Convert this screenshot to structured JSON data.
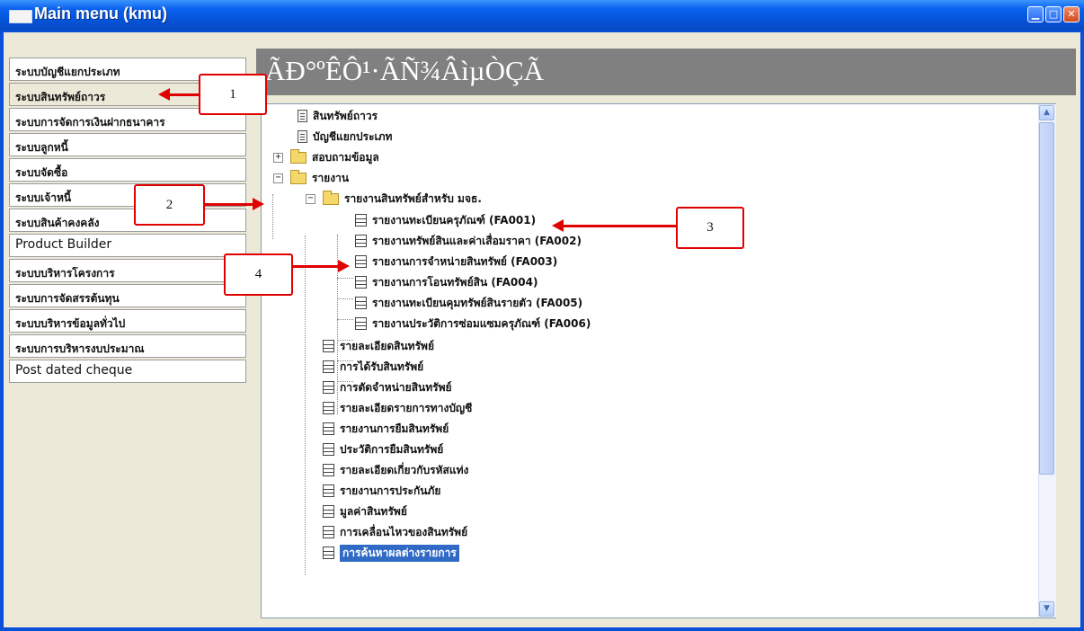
{
  "window": {
    "title": "Main menu (kmu)"
  },
  "sidebar": {
    "items": [
      {
        "label": "ระบบบัญชีแยกประเภท"
      },
      {
        "label": "ระบบสินทรัพย์ถาวร"
      },
      {
        "label": "ระบบการจัดการเงินฝากธนาคาร"
      },
      {
        "label": "ระบบลูกหนี้"
      },
      {
        "label": "ระบบจัดซื้อ"
      },
      {
        "label": "ระบบเจ้าหนี้"
      },
      {
        "label": "ระบบสินค้าคงคลัง"
      },
      {
        "label": "Product Builder"
      },
      {
        "label": "ระบบบริหารโครงการ"
      },
      {
        "label": "ระบบการจัดสรรต้นทุน"
      },
      {
        "label": "ระบบบริหารข้อมูลทั่วไป"
      },
      {
        "label": "ระบบการบริหารงบประมาณ"
      },
      {
        "label": "Post dated cheque"
      }
    ]
  },
  "header": {
    "title": "ÃÐ°ºÊÔ¹·ÃÑ¾ÂìµÒÇÃ"
  },
  "tree": {
    "nodes": [
      {
        "label": "สินทรัพย์ถาวร"
      },
      {
        "label": "บัญชีแยกประเภท"
      },
      {
        "label": "สอบถามข้อมูล"
      },
      {
        "label": "รายงาน"
      },
      {
        "label": "รายงานสินทรัพย์สำหรับ มจธ."
      },
      {
        "label": "รายงานทะเบียนครุภัณฑ์ (FA001)"
      },
      {
        "label": "รายงานทรัพย์สินและค่าเสื่อมราคา (FA002)"
      },
      {
        "label": "รายงานการจำหน่ายสินทรัพย์ (FA003)"
      },
      {
        "label": "รายงานการโอนทรัพย์สิน (FA004)"
      },
      {
        "label": "รายงานทะเบียนคุมทรัพย์สินรายตัว (FA005)"
      },
      {
        "label": "รายงานประวัติการซ่อมแซมครุภัณฑ์ (FA006)"
      },
      {
        "label": "รายละเอียดสินทรัพย์"
      },
      {
        "label": "การได้รับสินทรัพย์"
      },
      {
        "label": "การตัดจำหน่ายสินทรัพย์"
      },
      {
        "label": "รายละเอียดรายการทางบัญชี"
      },
      {
        "label": "รายงานการยืมสินทรัพย์"
      },
      {
        "label": "ประวัติการยืมสินทรัพย์"
      },
      {
        "label": "รายละเอียดเกี่ยวกับรหัสแท่ง"
      },
      {
        "label": "รายงานการประกันภัย"
      },
      {
        "label": "มูลค่าสินทรัพย์"
      },
      {
        "label": "การเคลื่อนไหวของสินทรัพย์"
      },
      {
        "label": "การค้นหาผลต่างรายการ"
      }
    ]
  },
  "callouts": [
    {
      "number": "1"
    },
    {
      "number": "2"
    },
    {
      "number": "3"
    },
    {
      "number": "4"
    }
  ],
  "colors": {
    "titlebar": "#0553d6",
    "header_bg": "#808080",
    "annotation": "#e00000",
    "selection": "#316ac5"
  }
}
